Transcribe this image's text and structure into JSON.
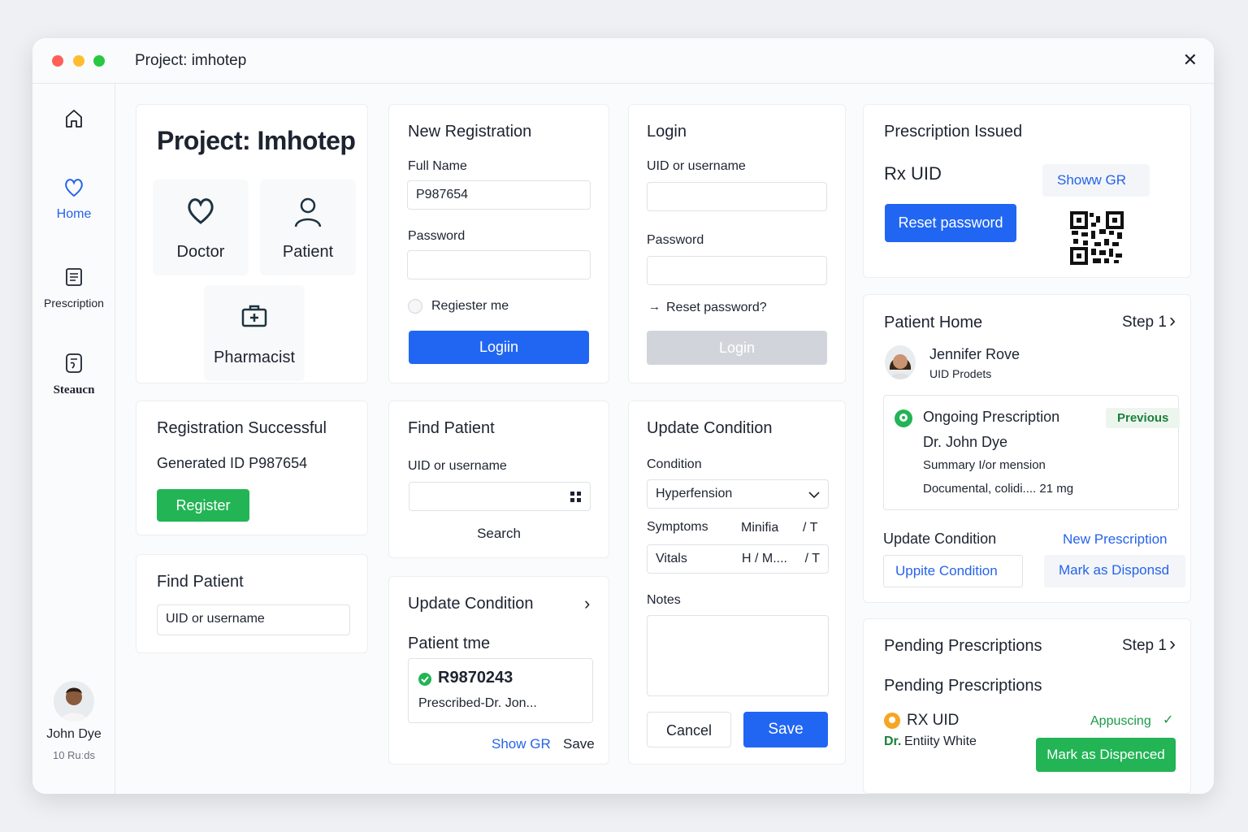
{
  "window": {
    "title": "Project: imhotep"
  },
  "sidebar": {
    "items": [
      {
        "label": "",
        "icon": "home-icon"
      },
      {
        "label": "Home",
        "icon": "heart-icon"
      },
      {
        "label": "Prescription",
        "icon": "document-icon"
      },
      {
        "label": "Steaucn",
        "icon": "notes-icon"
      }
    ],
    "user": {
      "name": "John Dye",
      "sub": "10 Ruːds"
    }
  },
  "project": {
    "title": "Project: Imhotep",
    "roles": [
      "Doctor",
      "Patient",
      "Pharmacist"
    ]
  },
  "registration_success": {
    "title": "Registration Successful",
    "generated": "Generated ID P987654",
    "button": "Register"
  },
  "find_patient_left": {
    "title": "Find Patient",
    "placeholder": "UID or username"
  },
  "new_registration": {
    "title": "New Registration",
    "full_name_label": "Full Name",
    "full_name_value": "P987654",
    "password_label": "Password",
    "remember_label": "Regiester me",
    "button": "Logiin"
  },
  "find_patient": {
    "title": "Find Patient",
    "label": "UID or username",
    "button": "Search"
  },
  "update_condition_mid": {
    "title": "Update Condition",
    "subtitle": "Patient tme",
    "rx_id": "R9870243",
    "rx_desc": "Prescribed-Dr. Jon...",
    "show_link": "Show GR",
    "save": "Save"
  },
  "login": {
    "title": "Login",
    "uid_label": "UID or username",
    "password_label": "Password",
    "reset_link": "Reset password?",
    "button": "Login"
  },
  "update_condition": {
    "title": "Update Condition",
    "condition_label": "Condition",
    "condition_value": "Hyperfension",
    "symptoms_label": "Symptoms",
    "symptoms_value": "Minifia",
    "symptoms_unit": "/ T",
    "vitals_label": "Vitals",
    "vitals_value": "H   / M....",
    "vitals_unit": "/ T",
    "notes_label": "Notes",
    "cancel": "Cancel",
    "save": "Save"
  },
  "prescription_issued": {
    "title": "Prescription Issued",
    "rx_label": "Rx UID",
    "show_link": "Showw GR",
    "button": "Reset password"
  },
  "patient_home": {
    "title": "Patient Home",
    "step": "Step 1",
    "name": "Jennifer Rove",
    "sub": "UID Prodets",
    "ongoing_title": "Ongoing Prescription",
    "previous": "Previous",
    "doctor": "Dr. John Dye",
    "summary": "Summary I/or mension",
    "doc_line": "Documental, colidi.... 21 mg",
    "update_label": "Update Condition",
    "new_rx_link": "New Prescription",
    "update_btn": "Uppite Condition",
    "mark_link": "Mark as Disponsd"
  },
  "pending": {
    "title": "Pending Prescriptions",
    "step": "Step 1",
    "subtitle": "Pending Prescriptions",
    "rx_label": "RX UID",
    "status": "Appuscing",
    "doctor_prefix": "Dr.",
    "doctor_name": "Entiity White",
    "button": "Mark as Dispenced"
  },
  "colors": {
    "accent": "#2166f3",
    "success": "#22b455",
    "muted": "#d1d5db"
  }
}
